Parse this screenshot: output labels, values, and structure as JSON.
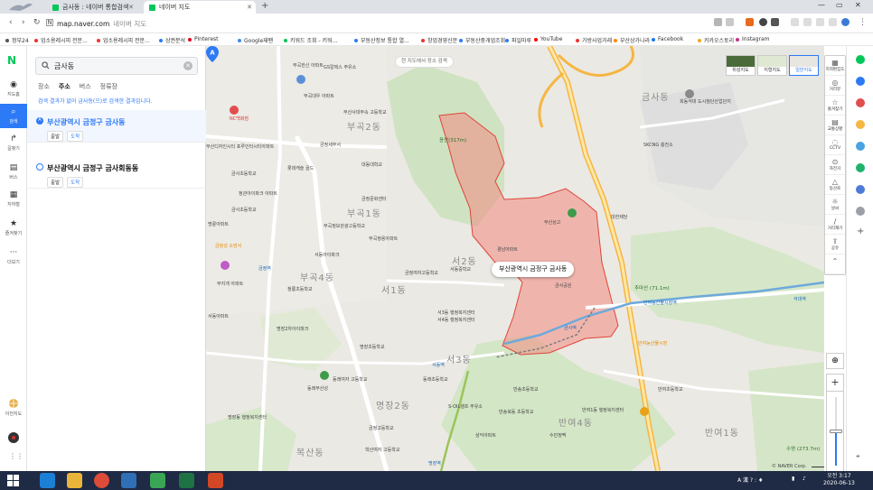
{
  "browser": {
    "tabs": [
      {
        "title": "금사동 : 네이버 통합검색",
        "color": "#03c75a"
      },
      {
        "title": "네이버 지도",
        "color": "#03c75a"
      }
    ],
    "url": "map.naver.com",
    "url_hint": "네이버 지도",
    "bookmarks": [
      {
        "label": "정부24",
        "color": "#555"
      },
      {
        "label": "업소용레시피 전문...",
        "color": "#e33"
      },
      {
        "label": "업소용레시피 전문...",
        "color": "#e33"
      },
      {
        "label": "상권분석",
        "color": "#2d7af6"
      },
      {
        "label": "Pinterest",
        "color": "#e60023"
      },
      {
        "label": "Google재팬",
        "color": "#4285f4"
      },
      {
        "label": "키워드 조회 - 키워...",
        "color": "#03c75a"
      },
      {
        "label": "부동산정보 통합 열...",
        "color": "#2d7af6"
      },
      {
        "label": "창업경영신문",
        "color": "#e33"
      },
      {
        "label": "부동산중개업조회",
        "color": "#2d7af6"
      },
      {
        "label": "파일마루",
        "color": "#2d7af6"
      },
      {
        "label": "YouTube",
        "color": "#f00"
      },
      {
        "label": "가방사업거래",
        "color": "#e33"
      },
      {
        "label": "부산상가나라",
        "color": "#f80"
      },
      {
        "label": "Facebook",
        "color": "#1877f2"
      },
      {
        "label": "카카오스토리",
        "color": "#f5a623"
      },
      {
        "label": "Instagram",
        "color": "#c13584"
      }
    ]
  },
  "rail": {
    "logo": "N",
    "items": [
      {
        "label": "지도홈",
        "icon": "◉"
      },
      {
        "label": "검색",
        "icon": "⌕"
      },
      {
        "label": "길찾기",
        "icon": "↱"
      },
      {
        "label": "버스",
        "icon": "▤"
      },
      {
        "label": "지하철",
        "icon": "▦"
      },
      {
        "label": "즐겨찾기",
        "icon": "★"
      },
      {
        "label": "더보기",
        "icon": "···"
      }
    ],
    "bottom": {
      "label": "이전지도"
    }
  },
  "search": {
    "query": "금사동",
    "tabs": [
      "장소",
      "주소",
      "버스",
      "정류장"
    ],
    "active_tab": "주소",
    "notice": "검색 결과가 없어 금사동(으)로 검색한 결과입니다.",
    "results": [
      {
        "marker": "A",
        "title": "부산광역시 금정구 금사동",
        "btn_start": "출발",
        "btn_arrive": "도착"
      },
      {
        "marker": "B",
        "title": "부산광역시 금정구 금사회동동",
        "btn_start": "출발",
        "btn_arrive": "도착"
      }
    ]
  },
  "map": {
    "research_button": "현 지도에서 장소 검색",
    "map_types": [
      {
        "label": "위성지도"
      },
      {
        "label": "지형지도"
      },
      {
        "label": "일반지도"
      }
    ],
    "callout": "부산광역시 금정구 금사동",
    "pin_marker": "A",
    "districts": [
      {
        "label": "부곡2동"
      },
      {
        "label": "부곡1동"
      },
      {
        "label": "부곡4동"
      },
      {
        "label": "서1동"
      },
      {
        "label": "서2동"
      },
      {
        "label": "서3동"
      },
      {
        "label": "금사동"
      },
      {
        "label": "명장2동"
      },
      {
        "label": "반여4동"
      },
      {
        "label": "반여1동"
      },
      {
        "label": "복산동"
      }
    ],
    "pois": [
      "부곡한신 아파트",
      "GS칼텍스 주유소",
      "NC백화점",
      "부곡대우 아파트",
      "부산사대부속 고등학교",
      "금정세무서",
      "대동대학교",
      "부산디자인시티 포루인터시티아파트",
      "롯데캐슬 골드",
      "정관아이파크 아파트",
      "금사초등학교",
      "부곡정보관광고등학교",
      "부곡쌍용아파트",
      "금정역",
      "청룡초등학교",
      "무지개 아파트",
      "서동아이파크",
      "금정여자고등학교",
      "서동아파트",
      "서동중학교",
      "금정성 소방서",
      "서4동 행정복지센터",
      "금사초등학교",
      "금정문화센터",
      "경남아파트",
      "부산상고",
      "금사역",
      "회동석대 도시첨단산업단지",
      "서3동 행정복지센터",
      "명장2차아이파크",
      "동래부산성",
      "명장초등학교",
      "반송초등학교",
      "반여초등학교",
      "명장동 행정복지센터",
      "금정고등학교",
      "석대역",
      "반여농산물시장역",
      "동래초등학교",
      "수민정맥",
      "SKCNG 충전소",
      "대한제당",
      "금사공원",
      "명륜아파트",
      "동래여자 고등학교",
      "학산여자 고등학교",
      "S-OIL셀프 주유소",
      "삼익아파트",
      "반여1동 행정복지센터",
      "반송북동 초등학교",
      "반여농산물시장"
    ],
    "peaks": [
      {
        "label": "윤산(317m)"
      },
      {
        "label": "추마산 (71.1m)"
      },
      {
        "label": "수영 (273.7m)"
      }
    ],
    "stations": [
      "서동역",
      "금사역",
      "반여농산물시장역",
      "석대역",
      "명장역"
    ],
    "scale": "© NAVER Corp.",
    "scale_bar": "300m"
  },
  "tools": [
    {
      "label": "지적편집도",
      "icon": "▦"
    },
    {
      "label": "거리뷰",
      "icon": "◎"
    },
    {
      "label": "즐겨찾기",
      "icon": "☆"
    },
    {
      "label": "교통상황",
      "icon": "▤"
    },
    {
      "label": "CCTV",
      "icon": "◌"
    },
    {
      "label": "자전거",
      "icon": "⊙"
    },
    {
      "label": "등산로",
      "icon": "△"
    },
    {
      "label": "날씨",
      "icon": "☼"
    },
    {
      "label": "거리재기",
      "icon": "∕"
    },
    {
      "label": "공유",
      "icon": "⇪"
    },
    {
      "label": "",
      "icon": "⌃"
    }
  ],
  "zoom": {
    "level_fraction": 0.5,
    "plus": "+",
    "minus": "−"
  },
  "taskbar": {
    "tray_text": "A 漢 ? : ♦",
    "time": "오전 3:17",
    "date": "2020-06-13"
  }
}
